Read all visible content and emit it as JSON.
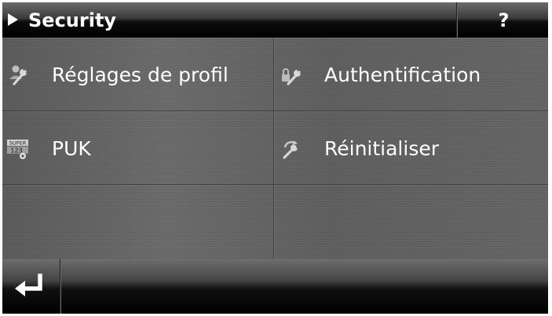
{
  "header": {
    "title": "Security",
    "help_label": "?"
  },
  "menu": {
    "items": [
      {
        "label": "Réglages de profil",
        "icon": "profile-settings-icon"
      },
      {
        "label": "Authentification",
        "icon": "authentication-icon"
      },
      {
        "label": "PUK",
        "icon": "puk-icon"
      },
      {
        "label": "Réinitialiser",
        "icon": "reset-icon"
      }
    ]
  },
  "puk_icon_text": {
    "top": "SUPER",
    "digits": "123"
  },
  "footer": {
    "back_icon": "return-arrow-icon"
  },
  "colors": {
    "text": "#ffffff",
    "tile": "#626262",
    "bar": "#000000"
  }
}
